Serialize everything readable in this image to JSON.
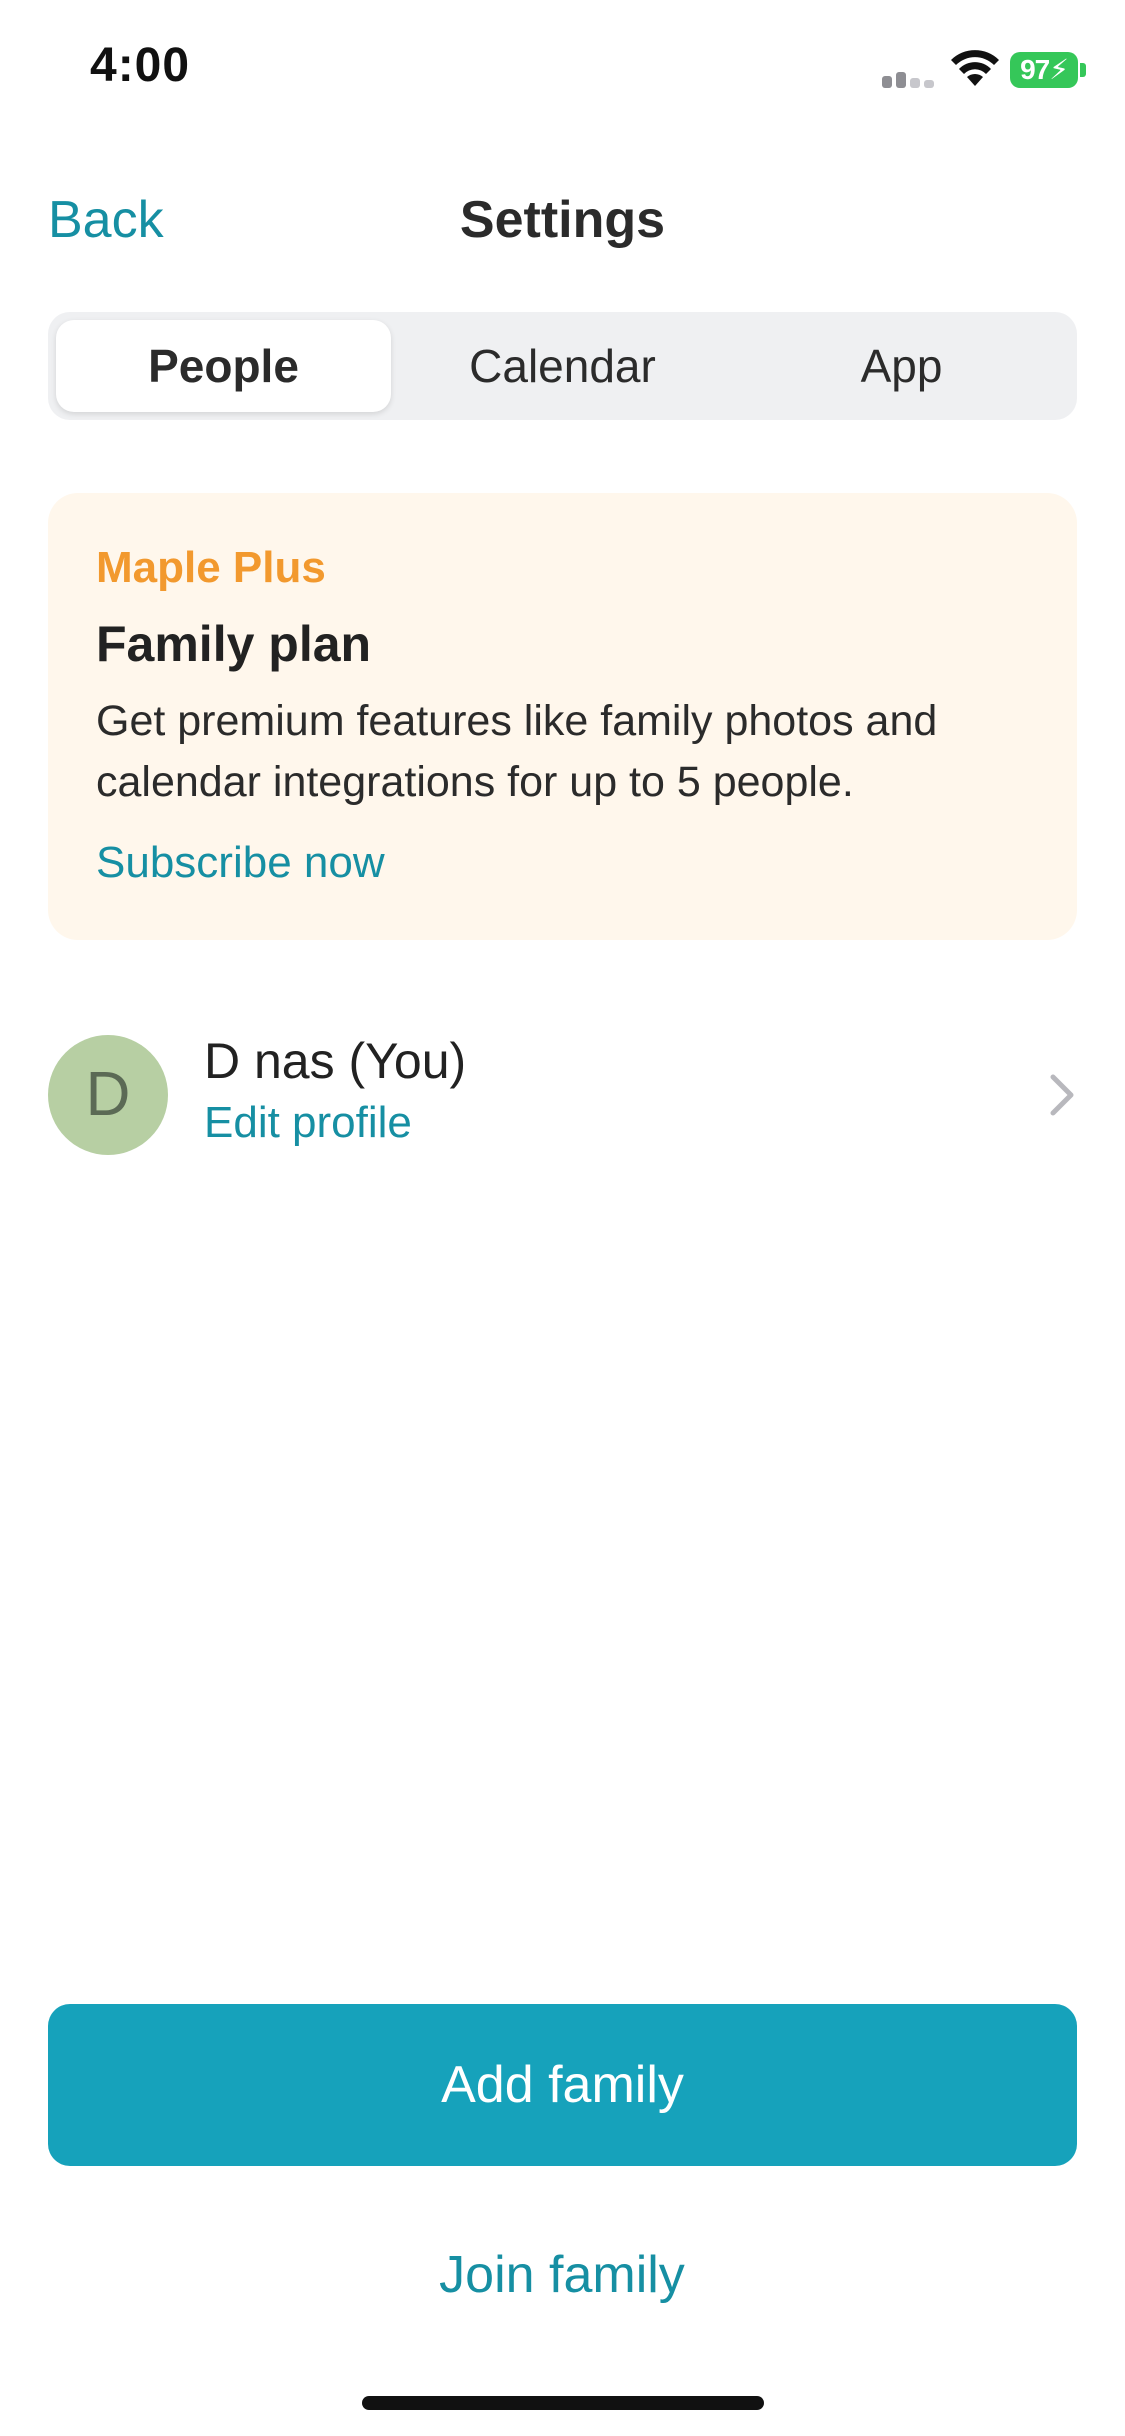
{
  "status_bar": {
    "time": "4:00",
    "battery": "97",
    "icons": [
      "cellular-signal-icon",
      "wifi-icon",
      "battery-charging-icon"
    ],
    "battery_color": "#35c759"
  },
  "nav": {
    "back_label": "Back",
    "title": "Settings"
  },
  "tabs": [
    {
      "label": "People",
      "selected": true
    },
    {
      "label": "Calendar",
      "selected": false
    },
    {
      "label": "App",
      "selected": false
    }
  ],
  "promo": {
    "eyebrow": "Maple Plus",
    "title": "Family plan",
    "body": "Get premium features like family photos and calendar integrations for up to 5 people.",
    "cta": "Subscribe now",
    "background": "#fff7ec",
    "eyebrow_color": "#f2992e"
  },
  "profile": {
    "initial": "D",
    "name": "D nas (You)",
    "edit_label": "Edit profile",
    "avatar_color": "#b7cfa3",
    "chevron_icon": "chevron-right-icon"
  },
  "actions": {
    "add_family": "Add family",
    "join_family": "Join family"
  },
  "colors": {
    "accent": "#168fa3",
    "primary_button": "#16a2bb"
  }
}
